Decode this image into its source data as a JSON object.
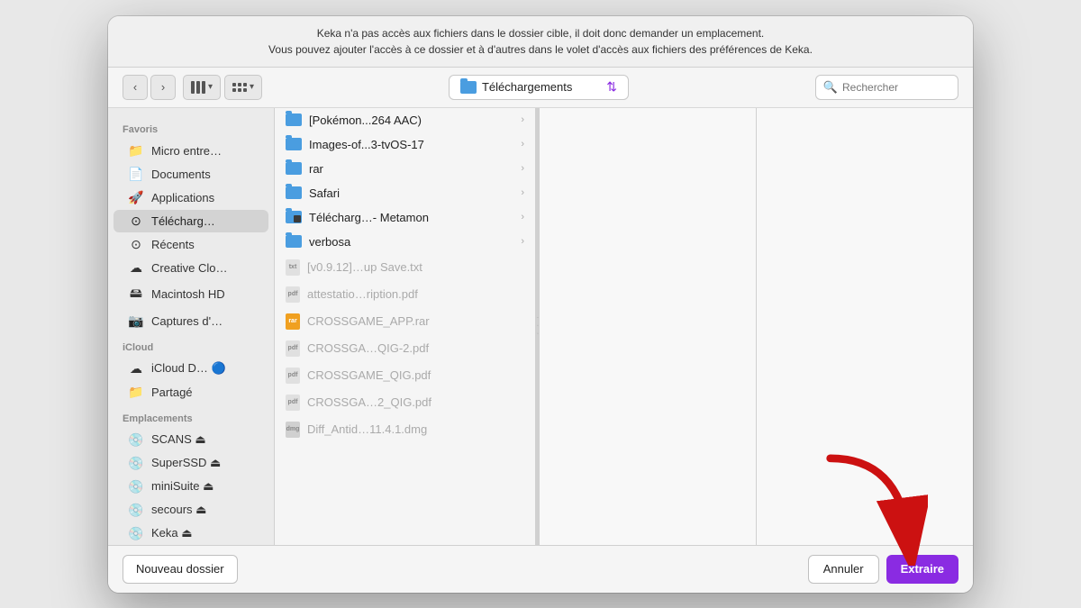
{
  "message": {
    "line1": "Keka n'a pas accès aux fichiers dans le dossier cible, il doit donc demander un emplacement.",
    "line2": "Vous pouvez ajouter l'accès à ce dossier et à d'autres dans le volet d'accès aux fichiers des préférences de Keka."
  },
  "toolbar": {
    "location": "Téléchargements",
    "search_placeholder": "Rechercher",
    "view_column_label": "⊞",
    "view_grid_label": "⊟"
  },
  "sidebar": {
    "sections": [
      {
        "label": "Favoris",
        "items": [
          {
            "icon": "📁",
            "text": "Micro entre…",
            "active": false
          },
          {
            "icon": "📄",
            "text": "Documents",
            "active": false
          },
          {
            "icon": "🚀",
            "text": "Applications",
            "active": false
          },
          {
            "icon": "⬇️",
            "text": "Télécharg…",
            "active": true
          },
          {
            "icon": "🕐",
            "text": "Récents",
            "active": false
          },
          {
            "icon": "☁️",
            "text": "Creative Clo…",
            "active": false
          },
          {
            "icon": "💾",
            "text": "Macintosh HD",
            "active": false
          },
          {
            "icon": "📷",
            "text": "Captures d'…",
            "active": false
          }
        ]
      },
      {
        "label": "iCloud",
        "items": [
          {
            "icon": "☁️",
            "text": "iCloud D… 🔵",
            "active": false
          },
          {
            "icon": "📁",
            "text": "Partagé",
            "active": false
          }
        ]
      },
      {
        "label": "Emplacements",
        "items": [
          {
            "icon": "💿",
            "text": "SCANS ⏏",
            "active": false
          },
          {
            "icon": "💿",
            "text": "SuperSSD ⏏",
            "active": false
          },
          {
            "icon": "💿",
            "text": "miniSuite ⏏",
            "active": false
          },
          {
            "icon": "💿",
            "text": "secours ⏏",
            "active": false
          },
          {
            "icon": "💿",
            "text": "Keka ⏏",
            "active": false
          }
        ]
      }
    ]
  },
  "files": [
    {
      "type": "folder",
      "name": "[Pokémon...264 AAC)",
      "hasChevron": true,
      "dimmed": false
    },
    {
      "type": "folder",
      "name": "Images-of...3-tvOS-17",
      "hasChevron": true,
      "dimmed": false
    },
    {
      "type": "folder",
      "name": "rar",
      "hasChevron": true,
      "dimmed": false
    },
    {
      "type": "folder",
      "name": "Safari",
      "hasChevron": true,
      "dimmed": false
    },
    {
      "type": "folder-special",
      "name": "Télécharg…- Metamon",
      "hasChevron": true,
      "dimmed": false
    },
    {
      "type": "folder",
      "name": "verbosa",
      "hasChevron": true,
      "dimmed": false
    },
    {
      "type": "txt",
      "name": "[v0.9.12]…up Save.txt",
      "hasChevron": false,
      "dimmed": true
    },
    {
      "type": "pdf",
      "name": "attestatio…ription.pdf",
      "hasChevron": false,
      "dimmed": true
    },
    {
      "type": "rar",
      "name": "CROSSGAME_APP.rar",
      "hasChevron": false,
      "dimmed": true
    },
    {
      "type": "pdf",
      "name": "CROSSGA…QIG-2.pdf",
      "hasChevron": false,
      "dimmed": true
    },
    {
      "type": "pdf",
      "name": "CROSSGAME_QIG.pdf",
      "hasChevron": false,
      "dimmed": true
    },
    {
      "type": "pdf",
      "name": "CROSSGA…2_QIG.pdf",
      "hasChevron": false,
      "dimmed": true
    },
    {
      "type": "dmg",
      "name": "Diff_Antid…11.4.1.dmg",
      "hasChevron": false,
      "dimmed": true
    }
  ],
  "buttons": {
    "new_folder": "Nouveau dossier",
    "cancel": "Annuler",
    "extract": "Extraire"
  },
  "colors": {
    "accent": "#8a2be2",
    "folder_blue": "#4a9de0",
    "arrow_red": "#cc2020"
  }
}
